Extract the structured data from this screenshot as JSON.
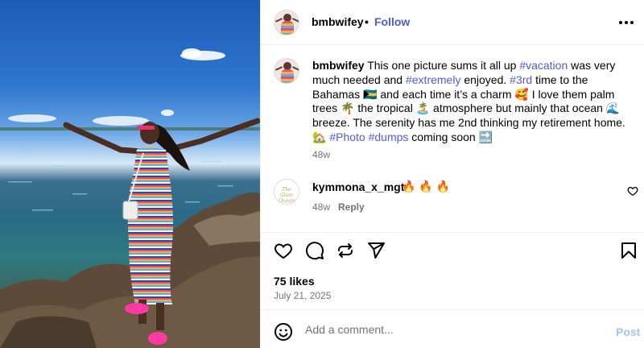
{
  "post": {
    "username": "bmbwifey",
    "separator": "•",
    "follow_label": "Follow",
    "caption": {
      "t1": "This one picture sums it all up ",
      "tag1": "#vacation",
      "t2": " was very much needed and ",
      "tag2": "#extremely",
      "t3": " enjoyed. ",
      "tag3": "#3rd",
      "t4": " time to the Bahamas 🇧🇸 and each time it’s a charm 🥰 I love them palm trees 🌴 the tropical 🏝️ atmosphere but mainly that ocean 🌊 breeze. The serenity has me 2nd thinking my retirement home. 🏡 ",
      "tag4": "#Photo",
      "t5": " ",
      "tag5": "#dumps",
      "t6": " coming soon 🔜"
    },
    "caption_age": "48w"
  },
  "comment": {
    "avatar_text": "The Glam Queens",
    "username": "kymmona_x_mgt",
    "text": "🔥 🔥 🔥",
    "age": "48w",
    "reply_label": "Reply"
  },
  "actions": {
    "likes": "75 likes",
    "date": "July 21, 2025"
  },
  "add_comment": {
    "placeholder": "Add a comment...",
    "post_label": "Post"
  },
  "colors": {
    "link": "#4f5bd5",
    "muted": "#737373",
    "post_disabled": "#a4c4f5"
  },
  "icons": [
    "more-icon",
    "heart-icon",
    "comment-icon",
    "share-icon",
    "send-icon",
    "bookmark-icon",
    "emoji-icon"
  ]
}
